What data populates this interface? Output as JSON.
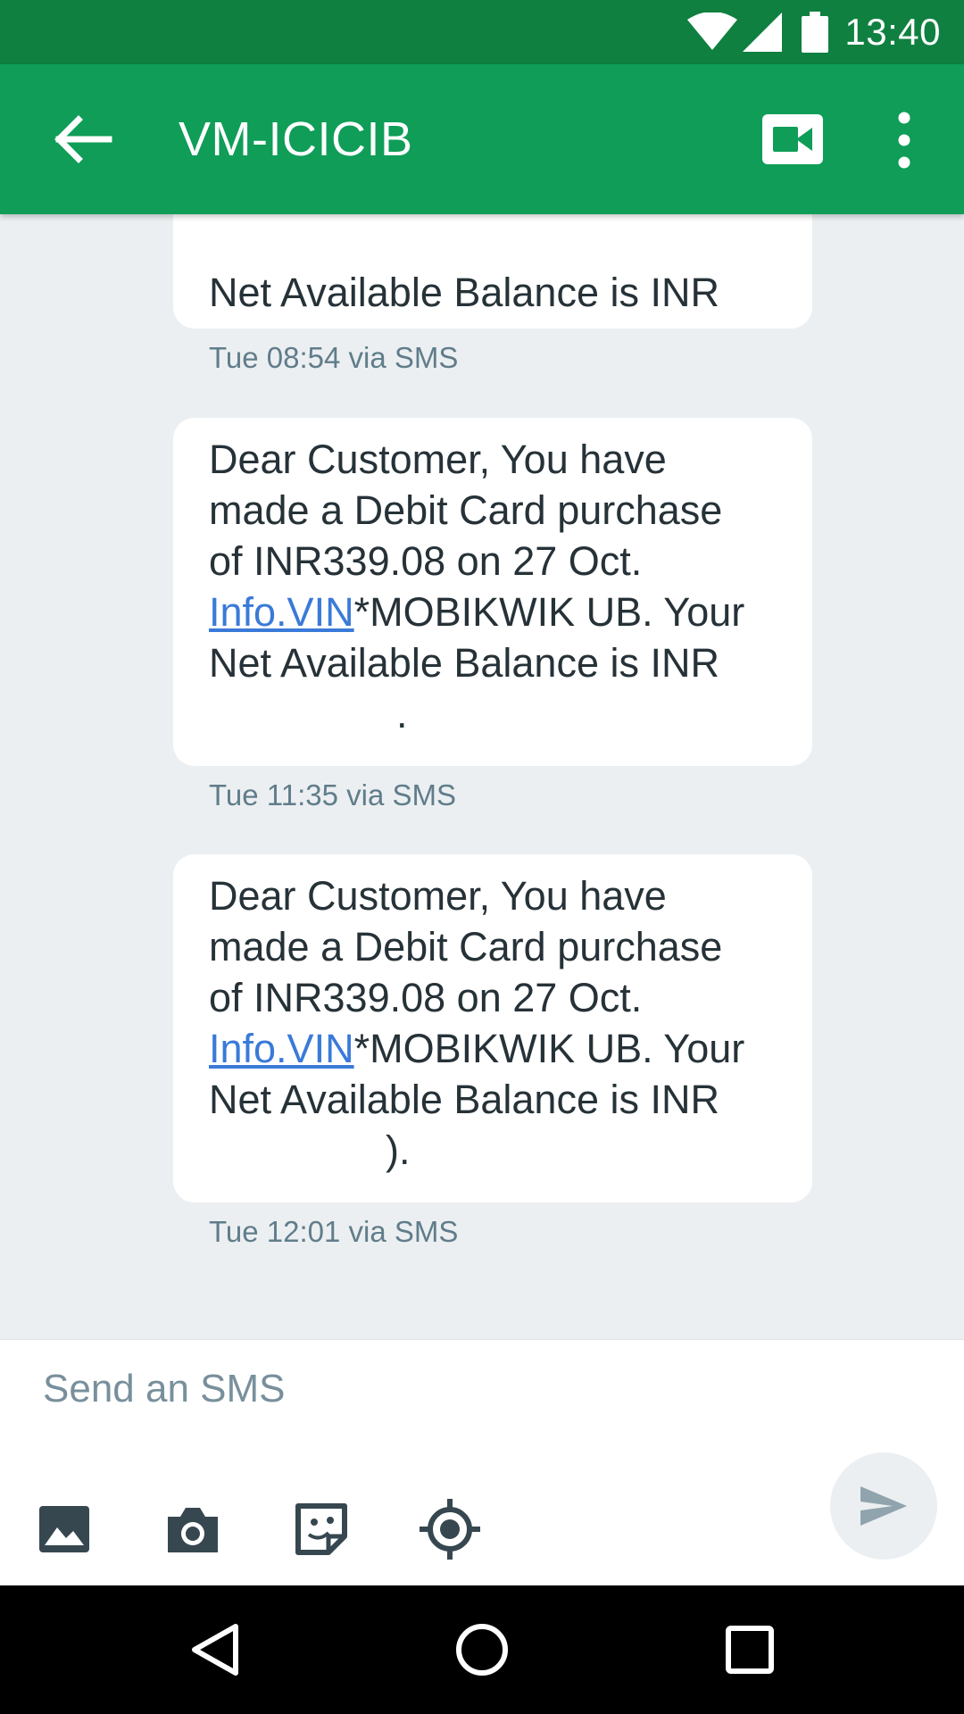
{
  "status_bar": {
    "time": "13:40",
    "icons": [
      "wifi-icon",
      "signal-icon",
      "battery-icon"
    ]
  },
  "app_bar": {
    "title": "VM-ICICIB",
    "icons": [
      "back-arrow-icon",
      "video-call-icon",
      "more-vert-icon"
    ],
    "background": "#0f9d58"
  },
  "messages": [
    {
      "lines_before_link": "Net Available Balance is INR",
      "link": "",
      "lines_after_link": "",
      "masked_tail": "",
      "timestamp": "Tue 08:54 via SMS"
    },
    {
      "lines_before_link": "Dear Customer, You have\nmade a Debit Card purchase\nof INR339.08 on 27 Oct.",
      "link": "Info.VIN",
      "lines_after_link": "*MOBIKWIK UB. Your\nNet Available Balance is INR",
      "masked_tail": ".",
      "timestamp": "Tue 11:35 via SMS"
    },
    {
      "lines_before_link": "Dear Customer, You have\nmade a Debit Card purchase\nof INR339.08 on 27 Oct.",
      "link": "Info.VIN",
      "lines_after_link": "*MOBIKWIK UB. Your\nNet Available Balance is INR",
      "masked_tail": ").",
      "timestamp": "Tue 12:01 via SMS"
    }
  ],
  "compose": {
    "placeholder": "Send an SMS",
    "tools": [
      "image-icon",
      "camera-icon",
      "sticker-icon",
      "location-icon"
    ],
    "send_icon": "send-icon"
  },
  "nav_bar": {
    "icons": [
      "back-triangle-icon",
      "home-circle-icon",
      "recents-square-icon"
    ]
  },
  "colors": {
    "status_bar": "#0f8040",
    "app_bar": "#0f9d58",
    "thread_background": "#eceff1",
    "link": "#3a7ad8",
    "meta_text": "#607d8b"
  }
}
